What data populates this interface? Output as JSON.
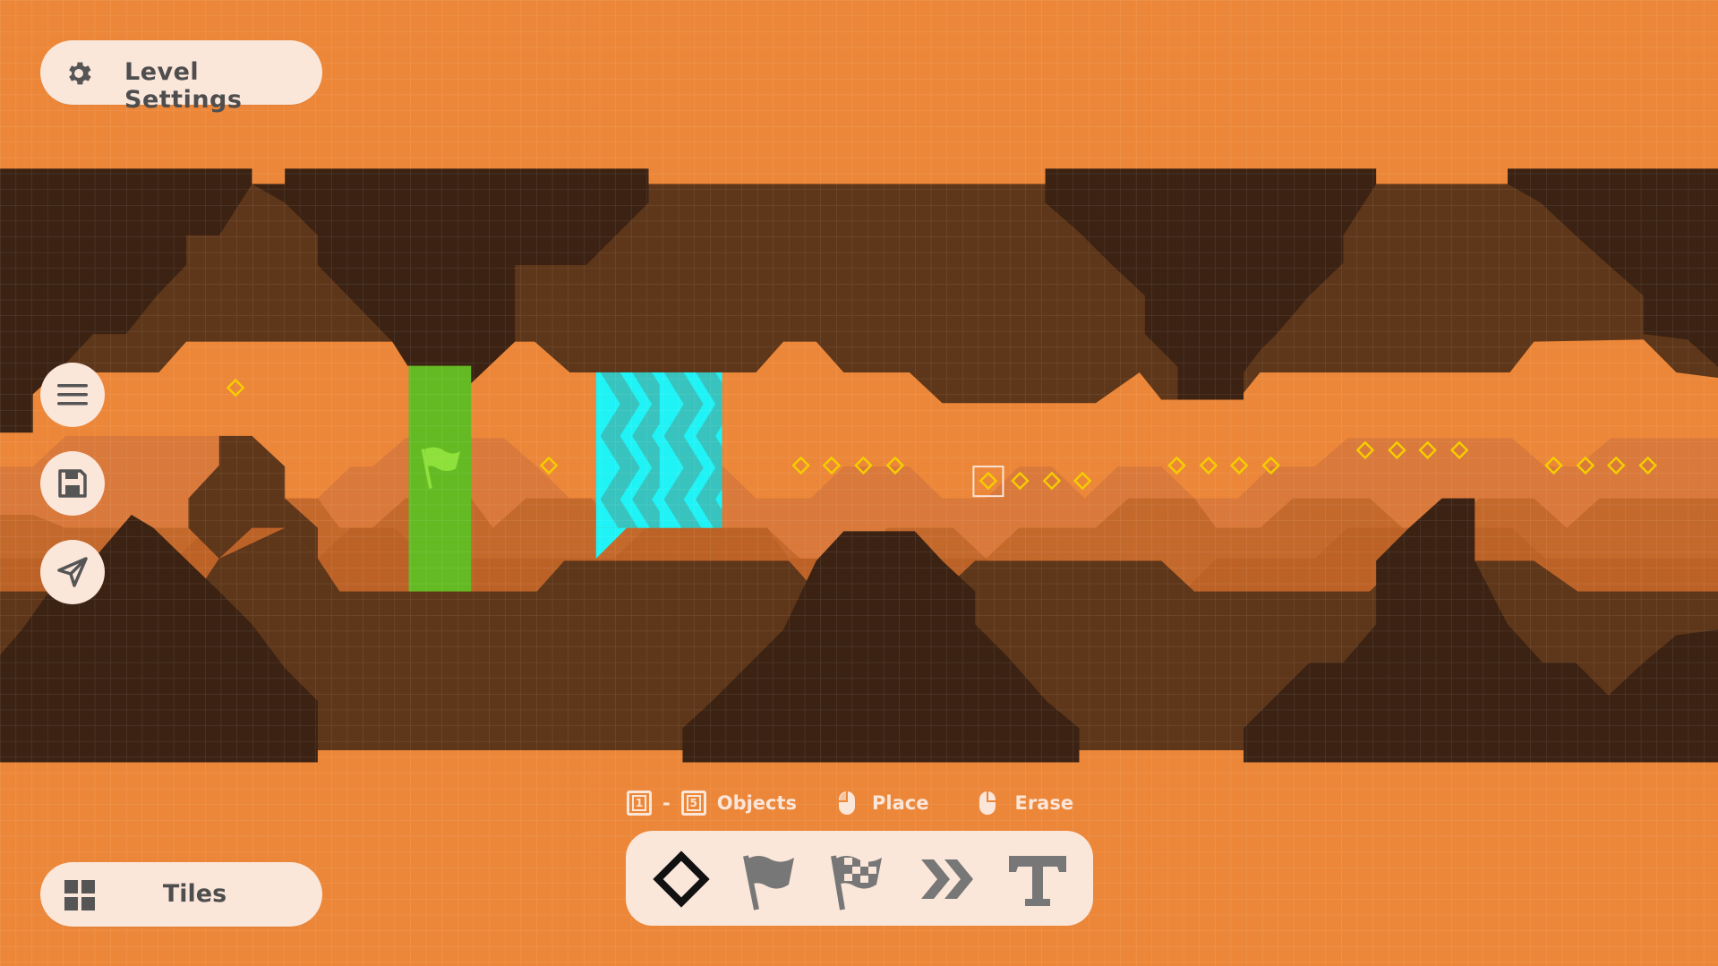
{
  "settings_button": {
    "label": "Level Settings",
    "icon": "gear-icon"
  },
  "tiles_button": {
    "label": "Tiles",
    "icon": "grid-icon"
  },
  "side_buttons": [
    {
      "icon": "menu-icon"
    },
    {
      "icon": "save-icon"
    },
    {
      "icon": "send-icon"
    }
  ],
  "hints": {
    "key_first": "1",
    "key_sep": "-",
    "key_last": "5",
    "objects_label": "Objects",
    "place_label": "Place",
    "erase_label": "Erase"
  },
  "toolbar": {
    "tools": [
      {
        "name": "gem-tool",
        "icon": "diamond-icon",
        "selected": true
      },
      {
        "name": "start-flag-tool",
        "icon": "flag-icon"
      },
      {
        "name": "finish-flag-tool",
        "icon": "checkered-flag-icon"
      },
      {
        "name": "boost-tool",
        "icon": "double-chevron-icon"
      },
      {
        "name": "text-tool",
        "icon": "text-icon"
      }
    ]
  },
  "colors": {
    "sky": "#ec8739",
    "dark_rock": "#3b2213",
    "mid_rock": "#5e3619",
    "light_layer": "#c4692c",
    "lighter_layer": "#d5773a",
    "start_zone": "#64ba23",
    "boost_zone": "#1ff3f6",
    "gem": "#f5cd00",
    "panel": "#fbe6da",
    "icon": "#555555"
  }
}
